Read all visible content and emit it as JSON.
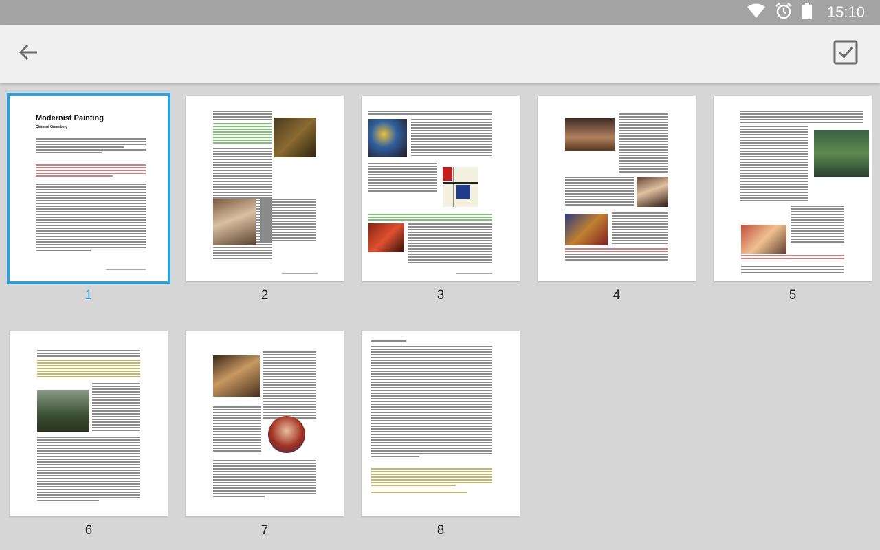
{
  "status": {
    "time": "15:10",
    "icons": [
      "wifi-icon",
      "alarm-icon",
      "battery-icon"
    ]
  },
  "appbar": {
    "back_icon": "arrow-left-icon",
    "done_icon": "checkbox-checked-icon"
  },
  "document": {
    "title": "Modernist Painting",
    "author": "Clement Greenberg"
  },
  "pages": [
    {
      "number": "1",
      "selected": true
    },
    {
      "number": "2",
      "selected": false
    },
    {
      "number": "3",
      "selected": false
    },
    {
      "number": "4",
      "selected": false
    },
    {
      "number": "5",
      "selected": false
    },
    {
      "number": "6",
      "selected": false
    },
    {
      "number": "7",
      "selected": false
    },
    {
      "number": "8",
      "selected": false
    }
  ],
  "colors": {
    "statusbar": "#a3a3a3",
    "appbar": "#f0f0f0",
    "background": "#d6d6d6",
    "selection": "#2ca3df"
  }
}
